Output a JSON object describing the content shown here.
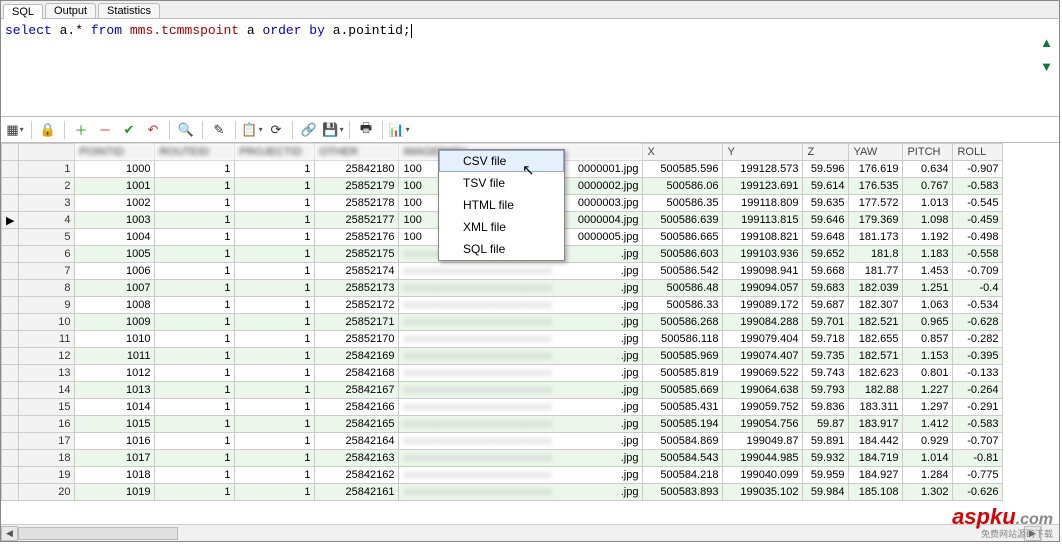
{
  "tabs": {
    "sql": "SQL",
    "output": "Output",
    "stats": "Statistics"
  },
  "sql": {
    "tokens": [
      "select",
      " a.* ",
      "from",
      " ",
      "mms.tcmmspoint",
      " a ",
      "order by",
      " a.pointid;"
    ]
  },
  "context_menu": {
    "items": [
      "CSV file",
      "TSV file",
      "HTML file",
      "XML file",
      "SQL file"
    ],
    "highlighted": 0
  },
  "columns": {
    "x": "X",
    "y": "Y",
    "z": "Z",
    "yaw": "YAW",
    "pitch": "PITCH",
    "roll": "ROLL"
  },
  "rows": [
    {
      "n": 1,
      "a": "1000",
      "b": "1",
      "c": "1",
      "d": "25842180",
      "e": "100",
      "f": "0000001.jpg",
      "x": "500585.596",
      "y": "199128.573",
      "z": "59.596",
      "yaw": "176.619",
      "pitch": "0.634",
      "roll": "-0.907"
    },
    {
      "n": 2,
      "a": "1001",
      "b": "1",
      "c": "1",
      "d": "25852179",
      "e": "100",
      "f": "0000002.jpg",
      "x": "500586.06",
      "y": "199123.691",
      "z": "59.614",
      "yaw": "176.535",
      "pitch": "0.767",
      "roll": "-0.583"
    },
    {
      "n": 3,
      "a": "1002",
      "b": "1",
      "c": "1",
      "d": "25852178",
      "e": "100",
      "f": "0000003.jpg",
      "x": "500586.35",
      "y": "199118.809",
      "z": "59.635",
      "yaw": "177.572",
      "pitch": "1.013",
      "roll": "-0.545"
    },
    {
      "n": 4,
      "ptr": true,
      "a": "1003",
      "b": "1",
      "c": "1",
      "d": "25852177",
      "e": "100",
      "f": "0000004.jpg",
      "x": "500586.639",
      "y": "199113.815",
      "z": "59.646",
      "yaw": "179.369",
      "pitch": "1.098",
      "roll": "-0.459"
    },
    {
      "n": 5,
      "a": "1004",
      "b": "1",
      "c": "1",
      "d": "25852176",
      "e": "100",
      "f": "0000005.jpg",
      "x": "500586.665",
      "y": "199108.821",
      "z": "59.648",
      "yaw": "181.173",
      "pitch": "1.192",
      "roll": "-0.498"
    },
    {
      "n": 6,
      "a": "1005",
      "b": "1",
      "c": "1",
      "d": "25852175",
      "e": "",
      "f": ".jpg",
      "x": "500586.603",
      "y": "199103.936",
      "z": "59.652",
      "yaw": "181.8",
      "pitch": "1.183",
      "roll": "-0.558"
    },
    {
      "n": 7,
      "a": "1006",
      "b": "1",
      "c": "1",
      "d": "25852174",
      "e": "",
      "f": ".jpg",
      "x": "500586.542",
      "y": "199098.941",
      "z": "59.668",
      "yaw": "181.77",
      "pitch": "1.453",
      "roll": "-0.709"
    },
    {
      "n": 8,
      "a": "1007",
      "b": "1",
      "c": "1",
      "d": "25852173",
      "e": "",
      "f": ".jpg",
      "x": "500586.48",
      "y": "199094.057",
      "z": "59.683",
      "yaw": "182.039",
      "pitch": "1.251",
      "roll": "-0.4"
    },
    {
      "n": 9,
      "a": "1008",
      "b": "1",
      "c": "1",
      "d": "25852172",
      "e": "",
      "f": ".jpg",
      "x": "500586.33",
      "y": "199089.172",
      "z": "59.687",
      "yaw": "182.307",
      "pitch": "1.063",
      "roll": "-0.534"
    },
    {
      "n": 10,
      "a": "1009",
      "b": "1",
      "c": "1",
      "d": "25852171",
      "e": "",
      "f": ".jpg",
      "x": "500586.268",
      "y": "199084.288",
      "z": "59.701",
      "yaw": "182.521",
      "pitch": "0.965",
      "roll": "-0.628"
    },
    {
      "n": 11,
      "a": "1010",
      "b": "1",
      "c": "1",
      "d": "25852170",
      "e": "",
      "f": ".jpg",
      "x": "500586.118",
      "y": "199079.404",
      "z": "59.718",
      "yaw": "182.655",
      "pitch": "0.857",
      "roll": "-0.282"
    },
    {
      "n": 12,
      "a": "1011",
      "b": "1",
      "c": "1",
      "d": "25842169",
      "e": "",
      "f": ".jpg",
      "x": "500585.969",
      "y": "199074.407",
      "z": "59.735",
      "yaw": "182.571",
      "pitch": "1.153",
      "roll": "-0.395"
    },
    {
      "n": 13,
      "a": "1012",
      "b": "1",
      "c": "1",
      "d": "25842168",
      "e": "",
      "f": ".jpg",
      "x": "500585.819",
      "y": "199069.522",
      "z": "59.743",
      "yaw": "182.623",
      "pitch": "0.801",
      "roll": "-0.133"
    },
    {
      "n": 14,
      "a": "1013",
      "b": "1",
      "c": "1",
      "d": "25842167",
      "e": "",
      "f": ".jpg",
      "x": "500585.669",
      "y": "199064.638",
      "z": "59.793",
      "yaw": "182.88",
      "pitch": "1.227",
      "roll": "-0.264"
    },
    {
      "n": 15,
      "a": "1014",
      "b": "1",
      "c": "1",
      "d": "25842166",
      "e": "",
      "f": ".jpg",
      "x": "500585.431",
      "y": "199059.752",
      "z": "59.836",
      "yaw": "183.311",
      "pitch": "1.297",
      "roll": "-0.291"
    },
    {
      "n": 16,
      "a": "1015",
      "b": "1",
      "c": "1",
      "d": "25842165",
      "e": "",
      "f": ".jpg",
      "x": "500585.194",
      "y": "199054.756",
      "z": "59.87",
      "yaw": "183.917",
      "pitch": "1.412",
      "roll": "-0.583"
    },
    {
      "n": 17,
      "a": "1016",
      "b": "1",
      "c": "1",
      "d": "25842164",
      "e": "",
      "f": ".jpg",
      "x": "500584.869",
      "y": "199049.87",
      "z": "59.891",
      "yaw": "184.442",
      "pitch": "0.929",
      "roll": "-0.707"
    },
    {
      "n": 18,
      "a": "1017",
      "b": "1",
      "c": "1",
      "d": "25842163",
      "e": "",
      "f": ".jpg",
      "x": "500584.543",
      "y": "199044.985",
      "z": "59.932",
      "yaw": "184.719",
      "pitch": "1.014",
      "roll": "-0.81"
    },
    {
      "n": 19,
      "a": "1018",
      "b": "1",
      "c": "1",
      "d": "25842162",
      "e": "",
      "f": ".jpg",
      "x": "500584.218",
      "y": "199040.099",
      "z": "59.959",
      "yaw": "184.927",
      "pitch": "1.284",
      "roll": "-0.775"
    },
    {
      "n": 20,
      "a": "1019",
      "b": "1",
      "c": "1",
      "d": "25842161",
      "e": "",
      "f": ".jpg",
      "x": "500583.893",
      "y": "199035.102",
      "z": "59.984",
      "yaw": "185.108",
      "pitch": "1.302",
      "roll": "-0.626"
    }
  ],
  "watermark": {
    "brand": "aspku",
    "tld": ".com",
    "tag": "免费网站源码下载"
  }
}
